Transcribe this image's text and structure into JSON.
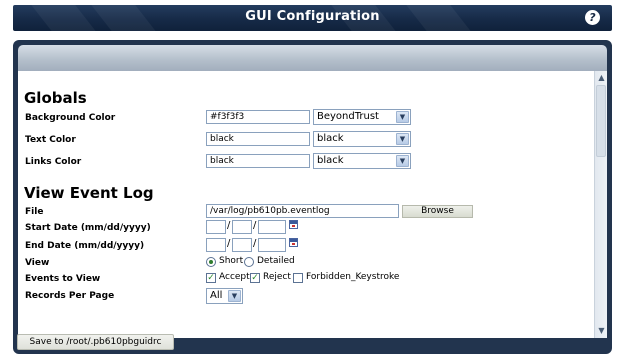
{
  "header": {
    "title": "GUI Configuration",
    "help_icon": "help-icon",
    "help_glyph": "?"
  },
  "globals": {
    "title": "Globals",
    "background_color": {
      "label": "Background Color",
      "value": "#f3f3f3",
      "select": "BeyondTrust"
    },
    "text_color": {
      "label": "Text Color",
      "value": "black",
      "select": "black"
    },
    "links_color": {
      "label": "Links Color",
      "value": "black",
      "select": "black"
    }
  },
  "event_log": {
    "title": "View Event Log",
    "file": {
      "label": "File",
      "value": "/var/log/pb610pb.eventlog",
      "browse_label": "Browse"
    },
    "start_date": {
      "label": "Start Date (mm/dd/yyyy)"
    },
    "end_date": {
      "label": "End Date (mm/dd/yyyy)"
    },
    "date_separator": "/",
    "view": {
      "label": "View",
      "options": [
        "Short",
        "Detailed"
      ],
      "selected": "Short"
    },
    "events": {
      "label": "Events to View",
      "options": [
        {
          "label": "Accept",
          "checked": true
        },
        {
          "label": "Reject",
          "checked": true
        },
        {
          "label": "Forbidden_Keystroke",
          "checked": false
        }
      ]
    },
    "records_per_page": {
      "label": "Records Per Page",
      "value": "All"
    }
  },
  "footer": {
    "save_label": "Save to /root/.pb610pbguidrc"
  },
  "glyphs": {
    "dropdown": "▼",
    "scroll_up": "▲",
    "scroll_down": "▼",
    "check": "✓"
  },
  "colors": {
    "titlebar": "#162a47",
    "panel": "#22344e",
    "header_gradient": "#b5c0cc"
  }
}
